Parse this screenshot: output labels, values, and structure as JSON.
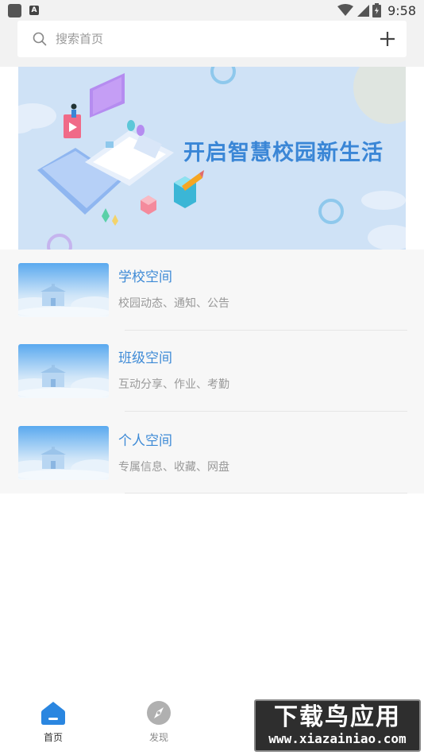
{
  "status_bar": {
    "time": "9:58",
    "left_badge": "A"
  },
  "search": {
    "placeholder": "搜索首页"
  },
  "banner": {
    "slogan": "开启智慧校园新生活"
  },
  "list": [
    {
      "title": "学校空间",
      "subtitle": "校园动态、通知、公告"
    },
    {
      "title": "班级空间",
      "subtitle": "互动分享、作业、考勤"
    },
    {
      "title": "个人空间",
      "subtitle": "专属信息、收藏、网盘"
    }
  ],
  "bottom_nav": [
    {
      "label": "首页",
      "active": true
    },
    {
      "label": "发现",
      "active": false
    }
  ],
  "watermark": {
    "line1": "下载鸟应用",
    "line2": "www.xiazainiao.com"
  },
  "colors": {
    "accent": "#3d8ad6",
    "nav_active": "#2a86e0",
    "nav_inactive": "#b0b0b0"
  }
}
